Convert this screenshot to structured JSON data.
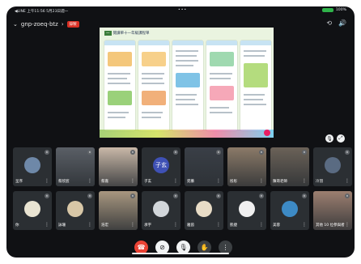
{
  "status_bar": {
    "left": "◀LINE 上午11:56 5月23日週一",
    "center": "•••",
    "battery_percent": "100%"
  },
  "meeting": {
    "code": "gnp-zoeq-btz",
    "recording_badge": "錄製"
  },
  "slide": {
    "title": "閱讀單十一年級課程單",
    "badge": "一"
  },
  "participants_row1": [
    {
      "name": "呈序",
      "type": "avatar",
      "color": "#6e88a8"
    },
    {
      "name": "蔡欣宸",
      "type": "video",
      "color": "#5a5f66"
    },
    {
      "name": "蔡嘉",
      "type": "video",
      "color": "#c9b8a8"
    },
    {
      "name": "子玄",
      "type": "initial",
      "initial": "子玄",
      "color": "#3f51b5"
    },
    {
      "name": "宛蓁",
      "type": "video",
      "color": "#3a3f47"
    },
    {
      "name": "彤彤",
      "type": "video",
      "color": "#8b7a68"
    },
    {
      "name": "陳哥老師",
      "type": "video",
      "color": "#6b6258"
    },
    {
      "name": "冷羽",
      "type": "avatar",
      "color": "#5a6b82"
    }
  ],
  "participants_row2": [
    {
      "name": "你",
      "type": "avatar",
      "color": "#e9e4d2"
    },
    {
      "name": "詠珊",
      "type": "avatar",
      "color": "#d8c7a7"
    },
    {
      "name": "浩宏",
      "type": "video",
      "color": "#a89780"
    },
    {
      "name": "承宇",
      "type": "avatar",
      "color": "#d2d6da"
    },
    {
      "name": "雅茵",
      "type": "avatar",
      "color": "#e8dcc6"
    },
    {
      "name": "凱捷",
      "type": "avatar",
      "color": "#f0f0f0"
    },
    {
      "name": "美蓉",
      "type": "avatar",
      "color": "#3d8ac5"
    },
    {
      "name": "其他 10 位參與者",
      "type": "video",
      "color": "#9c7f70"
    }
  ],
  "controls": {
    "end_call_icon": "phone-hangup-icon",
    "camera_icon": "camera-off-icon",
    "mic_icon": "mic-off-icon",
    "raise_hand_icon": "hand-icon",
    "more_icon": "more-icon"
  }
}
